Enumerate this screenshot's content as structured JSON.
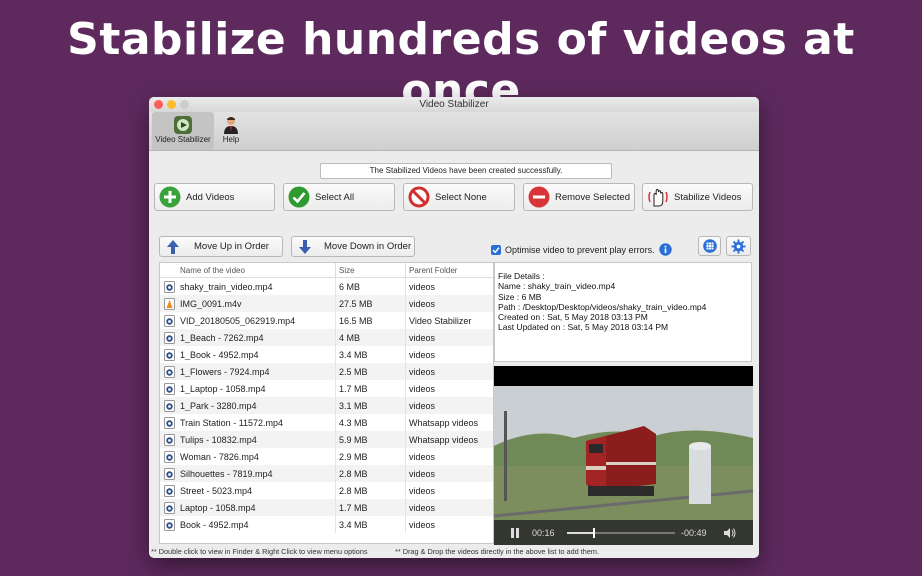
{
  "headline": "Stabilize hundreds of videos at once",
  "window": {
    "title": "Video Stabilizer"
  },
  "toolbar": {
    "video_stabilizer": "Video Stabilizer",
    "help": "Help"
  },
  "status_message": "The Stabilized Videos have been created successfully.",
  "buttons": {
    "add_videos": "Add Videos",
    "select_all": "Select All",
    "select_none": "Select None",
    "remove_selected": "Remove Selected",
    "stabilize_videos": "Stabilize Videos",
    "move_up": "Move Up in Order",
    "move_down": "Move Down in Order"
  },
  "optimise": {
    "label": "Optimise video to prevent play errors.",
    "checked": true
  },
  "table": {
    "headers": [
      "Name of the video",
      "Size",
      "Parent Folder"
    ],
    "rows": [
      {
        "name": "shaky_train_video.mp4",
        "size": "6 MB",
        "folder": "videos",
        "icon": "quicktime-file-icon"
      },
      {
        "name": "IMG_0091.m4v",
        "size": "27.5 MB",
        "folder": "videos",
        "icon": "vlc-file-icon"
      },
      {
        "name": "VID_20180505_062919.mp4",
        "size": "16.5 MB",
        "folder": "Video Stabilizer",
        "icon": "quicktime-file-icon"
      },
      {
        "name": "1_Beach - 7262.mp4",
        "size": "4 MB",
        "folder": "videos",
        "icon": "quicktime-file-icon"
      },
      {
        "name": "1_Book - 4952.mp4",
        "size": "3.4 MB",
        "folder": "videos",
        "icon": "quicktime-file-icon"
      },
      {
        "name": "1_Flowers - 7924.mp4",
        "size": "2.5 MB",
        "folder": "videos",
        "icon": "quicktime-file-icon"
      },
      {
        "name": "1_Laptop - 1058.mp4",
        "size": "1.7 MB",
        "folder": "videos",
        "icon": "quicktime-file-icon"
      },
      {
        "name": "1_Park - 3280.mp4",
        "size": "3.1 MB",
        "folder": "videos",
        "icon": "quicktime-file-icon"
      },
      {
        "name": "Train Station - 11572.mp4",
        "size": "4.3 MB",
        "folder": "Whatsapp videos",
        "icon": "quicktime-file-icon"
      },
      {
        "name": "Tulips - 10832.mp4",
        "size": "5.9 MB",
        "folder": "Whatsapp videos",
        "icon": "quicktime-file-icon"
      },
      {
        "name": "Woman - 7826.mp4",
        "size": "2.9 MB",
        "folder": "videos",
        "icon": "quicktime-file-icon"
      },
      {
        "name": "Silhouettes - 7819.mp4",
        "size": "2.8 MB",
        "folder": "videos",
        "icon": "quicktime-file-icon"
      },
      {
        "name": "Street - 5023.mp4",
        "size": "2.8 MB",
        "folder": "videos",
        "icon": "quicktime-file-icon"
      },
      {
        "name": "Laptop - 1058.mp4",
        "size": "1.7 MB",
        "folder": "videos",
        "icon": "quicktime-file-icon"
      },
      {
        "name": "Book - 4952.mp4",
        "size": "3.4 MB",
        "folder": "videos",
        "icon": "quicktime-file-icon"
      }
    ]
  },
  "details": {
    "heading": "File Details :",
    "name": "Name : shaky_train_video.mp4",
    "size": "Size : 6 MB",
    "path": "Path : /Desktop/Desktop/videos/shaky_train_video.mp4",
    "created": "Created on : Sat, 5 May 2018 03:13 PM",
    "updated": "Last Updated on : Sat, 5 May 2018 03:14 PM"
  },
  "player": {
    "elapsed": "00:16",
    "remaining": "-00:49",
    "progress": 0.25
  },
  "footer": {
    "left": "** Double click to view in Finder & Right Click  to view menu options",
    "right": "** Drag & Drop the videos directly in the above list to add them."
  },
  "colors": {
    "background": "#5e2a5e",
    "add_green": "#3aa23a",
    "select_green": "#2f9a2f",
    "none_red": "#d32f2f",
    "remove_red": "#d9343a",
    "accent_blue": "#2b6fd6"
  }
}
